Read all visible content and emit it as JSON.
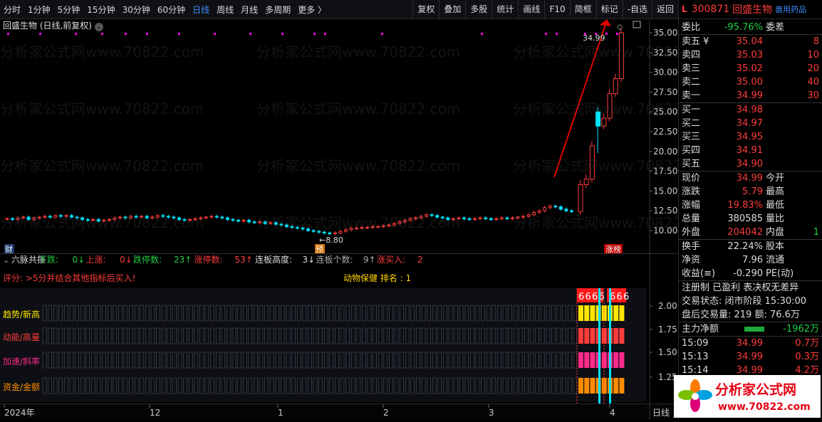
{
  "toolbar": {
    "periods": [
      "分时",
      "1分钟",
      "5分钟",
      "15分钟",
      "30分钟",
      "60分钟",
      "日线",
      "周线",
      "月线",
      "多周期",
      "更多 〉"
    ],
    "active": "日线",
    "tools": [
      "复权",
      "叠加",
      "多股",
      "统计",
      "画线",
      "F10",
      "简框",
      "标记",
      "-自选",
      "返回"
    ]
  },
  "chart": {
    "title": "回盛生物 (日线,前复权)",
    "y_ticks": [
      "35.00",
      "32.50",
      "30.00",
      "27.50",
      "25.00",
      "22.50",
      "20.00",
      "17.50",
      "15.00",
      "12.50",
      "10.00"
    ],
    "low_label": "8.80",
    "high_label": "34.99",
    "marker_cai": "财",
    "marker_yu": "预",
    "marker_zb": "涨榜",
    "watermark": "分析家公式网www.70822.com"
  },
  "indicator": {
    "name": "六脉共振",
    "xd_label": "下跌:",
    "xd": "0",
    "sz_label": "上涨:",
    "sz": "0",
    "dt_label": "跌停数:",
    "dt": "23",
    "zt_label": "涨停数:",
    "zt": "53",
    "lb_label": "连板高度:",
    "lb": "3",
    "lbg_label": "连板个数:",
    "lbg": "9",
    "zm_label": "涨买入:",
    "zm": "2",
    "pf": "评分: >5分并结合其他指标后买入!",
    "bk": "动物保健  排名 :  1",
    "rows": [
      "趋势/新高",
      "动能/高量",
      "加速/斜率",
      "资金/金额"
    ],
    "six": [
      "6",
      "6",
      "6",
      "6",
      "6",
      "6",
      "6"
    ],
    "y_ticks": [
      "2.00",
      "1.75",
      "1.50",
      "1.25"
    ]
  },
  "xaxis": {
    "labels": [
      "2024年",
      "12",
      "1",
      "2",
      "3",
      "4"
    ],
    "period": "日线"
  },
  "right": {
    "code": "300871",
    "name": "回盛生物",
    "sector": "兽用药品",
    "wb_label": "委比",
    "wb": "-95.76%",
    "wc_label": "委差",
    "asks": [
      {
        "l": "卖五 ¥",
        "p": "35.04",
        "v": "8"
      },
      {
        "l": "卖四",
        "p": "35.03",
        "v": "10"
      },
      {
        "l": "卖三",
        "p": "35.02",
        "v": "20"
      },
      {
        "l": "卖二",
        "p": "35.00",
        "v": "40"
      },
      {
        "l": "卖一",
        "p": "34.99",
        "v": "30"
      }
    ],
    "bids": [
      {
        "l": "买一",
        "p": "34.98"
      },
      {
        "l": "买二",
        "p": "34.97"
      },
      {
        "l": "买三",
        "p": "34.95"
      },
      {
        "l": "买四",
        "p": "34.91"
      },
      {
        "l": "买五",
        "p": "34.90"
      }
    ],
    "stats": [
      {
        "a": "现价",
        "b": "34.99",
        "c": "今开",
        "bc": "red"
      },
      {
        "a": "涨跌",
        "b": "5.79",
        "c": "最高",
        "bc": "red"
      },
      {
        "a": "涨幅",
        "b": "19.83%",
        "c": "最低",
        "bc": "red"
      },
      {
        "a": "总量",
        "b": "380585",
        "c": "量比",
        "bc": "wht"
      },
      {
        "a": "外盘",
        "b": "204042",
        "c": "内盘",
        "bc": "red",
        "d": "1"
      }
    ],
    "f": [
      {
        "a": "换手",
        "b": "22.24%",
        "c": "股本"
      },
      {
        "a": "净资",
        "b": "7.96",
        "c": "流通"
      },
      {
        "a": "收益(≡)",
        "b": "-0.290",
        "c": "PE(动)"
      }
    ],
    "tags": "注册制 已盈利 表决权无差异",
    "status": "交易状态: 闭市阶段 15:30:00",
    "after": "盘后交易量: 219  额: 76.6万",
    "zl_label": "主力净额",
    "zl": "-1962万",
    "ticks": [
      {
        "t": "15:09",
        "p": "34.99",
        "v": "0.7万"
      },
      {
        "t": "15:13",
        "p": "34.99",
        "v": "0.3万"
      },
      {
        "t": "15:14",
        "p": "34.99",
        "v": "4.2万"
      }
    ]
  },
  "logo": {
    "text": "分析家公式网",
    "url": "www.70822.com"
  },
  "colors": {
    "up": "#ff3c3c",
    "down": "#00e5ff",
    "bg": "#000000",
    "accent": "#3c8cff",
    "magenta": "#ff00ff"
  }
}
